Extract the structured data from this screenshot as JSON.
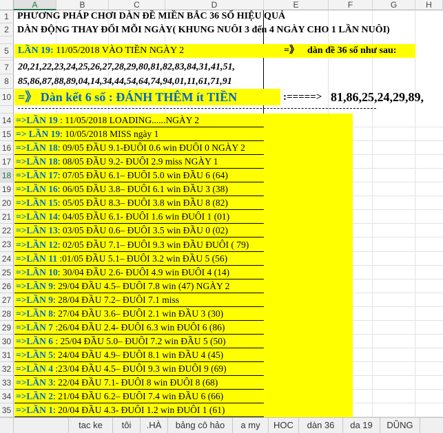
{
  "columns": [
    "A",
    "B",
    "C",
    "D",
    "E",
    "F",
    "G",
    "H"
  ],
  "selected_column": "A",
  "row_numbers": [
    "1",
    "2",
    "5",
    "7",
    "8",
    "10",
    "14",
    "15",
    "16",
    "17",
    "18",
    "19",
    "20",
    "21",
    "22",
    "23",
    "24",
    "25",
    "26",
    "27",
    "28",
    "29",
    "30",
    "31",
    "32",
    "33",
    "34",
    "35"
  ],
  "selected_row": "18",
  "title1": "PHƯƠNG PHÁP CHƠI DÀN ĐỀ MIỀN BẮC 36 SỐ HIỆU QUẢ",
  "title2": "DÀN ĐỘNG THAY ĐỔI MỖI NGÀY( KHUNG NUÔI 3 đến 4 NGÀY CHO 1 LẦN NUÔI)",
  "row5": {
    "prefix": "LẦN 19:",
    "text": " 11/05/2018 VÀO TIỀN NGÀY 2",
    "arrow": "=》",
    "right": "dàn đề 36 số như sau:"
  },
  "row7": "20,21,22,23,24,25,26,27,28,29,80,81,82,83,84,31,41,51,",
  "row8": "85,86,87,88,89,04,14,34,44,54,64,74,94,01,11,61,71,91",
  "row10": {
    "left": "=》 Dàn kết 6 số : ĐÁNH THÊM ít TIỀN",
    "arrow": ":=====>",
    "right": "81,86,25,24,29,89,"
  },
  "lan_rows": [
    {
      "prefix": "=>LẦN 19",
      "text": " : 11/05/2018 LOADING......NGÀY 2"
    },
    {
      "prefix": "=> LẦN 19",
      "text": ": 10/05/2018 MISS ngày 1"
    },
    {
      "prefix": "=>LẦN 18",
      "text": ": 09/05 ĐẦU 9.1-ĐUÔI 0.6 win ĐUÔI 0 NGÀY 2"
    },
    {
      "prefix": "=>LẦN 18",
      "text": ": 08/05 ĐẦU 9.2- ĐUÔI 2.9 miss NGÀY 1"
    },
    {
      "prefix": "=>LẦN 17",
      "text": ": 07/05 ĐẦU 6.1– ĐUÔI 5.0 win ĐẦU 6 (64)"
    },
    {
      "prefix": "=>LẦN 16",
      "text": ": 06/05 ĐẦU 3.8– ĐUÔI 6.1 win ĐẦU 3 (38)"
    },
    {
      "prefix": "=>LẦN 15",
      "text": ": 05/05 ĐẦU 8.3– ĐUÔI 3.8 win ĐẦU 8 (82)"
    },
    {
      "prefix": "=>LẦN 14",
      "text": ": 04/05 ĐẦU 6.1- ĐUÔI 1.6 win ĐUÔI 1 (01)"
    },
    {
      "prefix": "=>LẦN 13",
      "text": ": 03/05 ĐẦU 0.6– ĐUÔI 3.5 win ĐẦU 0 (02)"
    },
    {
      "prefix": "=>LẦN 12",
      "text": ": 02/05 ĐẦU 7.1– ĐUÔI 9.3 win ĐẦU ĐUÔI ( 79)"
    },
    {
      "prefix": "=>LẦN 11",
      "text": " :01/05 ĐẦU 5.1– ĐUÔI 3.2 win ĐẦU 5 (56)"
    },
    {
      "prefix": "=>LẦN 10",
      "text": ": 30/04 ĐẦU 2.6- ĐUÔI 4.9 win ĐUÔI 4 (14)"
    },
    {
      "prefix": "=>LẦN 9",
      "text": ": 29/04 ĐẦU 4.5– ĐUÔI 7.8 win (47) NGÀY 2"
    },
    {
      "prefix": "=>LẦN 9",
      "text": ": 28/04 ĐẦU 7.2– ĐUÔI 7.1 miss"
    },
    {
      "prefix": "=>LẦN 8",
      "text": ": 27/04 ĐẦU 3.6– ĐUÔI 2.1 win ĐẦU 3 (30)"
    },
    {
      "prefix": "=>LẦN 7",
      "text": " :26/04 ĐẦU 2.4- ĐUÔI 6.3 win ĐUÔI 6 (86)"
    },
    {
      "prefix": "=>LẦN 6",
      "text": " : 25/04 ĐẦU 5.0– ĐUÔI 7.2 win ĐẦU 5 (50)"
    },
    {
      "prefix": "=>LẦN 5",
      "text": ": 24/04 ĐẦU 4.9– ĐUÔI 8.1 win ĐẦU 4 (45)"
    },
    {
      "prefix": "=>LẦN 4",
      "text": " :23/04 ĐẦU 4.5– ĐUÔI 9.3 win ĐUÔI 9 (69)"
    },
    {
      "prefix": "=>LẦN 3",
      "text": ": 22/04 ĐẦU 7.1- ĐUÔI 8 win ĐUÔI 8 (68)"
    },
    {
      "prefix": "=>LẦN 2",
      "text": ": 21/04 ĐẦU 6.2– ĐUÔI 7.4 win ĐẦU 6 (66)"
    },
    {
      "prefix": "=>LẦN 1",
      "text": ": 20/04 ĐẦU 4.3- ĐUÔI 1.2 win ĐUÔI 1 (61)"
    }
  ],
  "sheet_tabs": [
    "tac ke",
    "tôi",
    ".HÀ",
    "bảng cô hảo",
    "a my",
    "HOC",
    "dàn 36",
    "da 19",
    "DŨNG"
  ],
  "colors": {
    "highlight": "#ffff00",
    "accent_blue": "#0066cc",
    "excel_green": "#217346"
  }
}
